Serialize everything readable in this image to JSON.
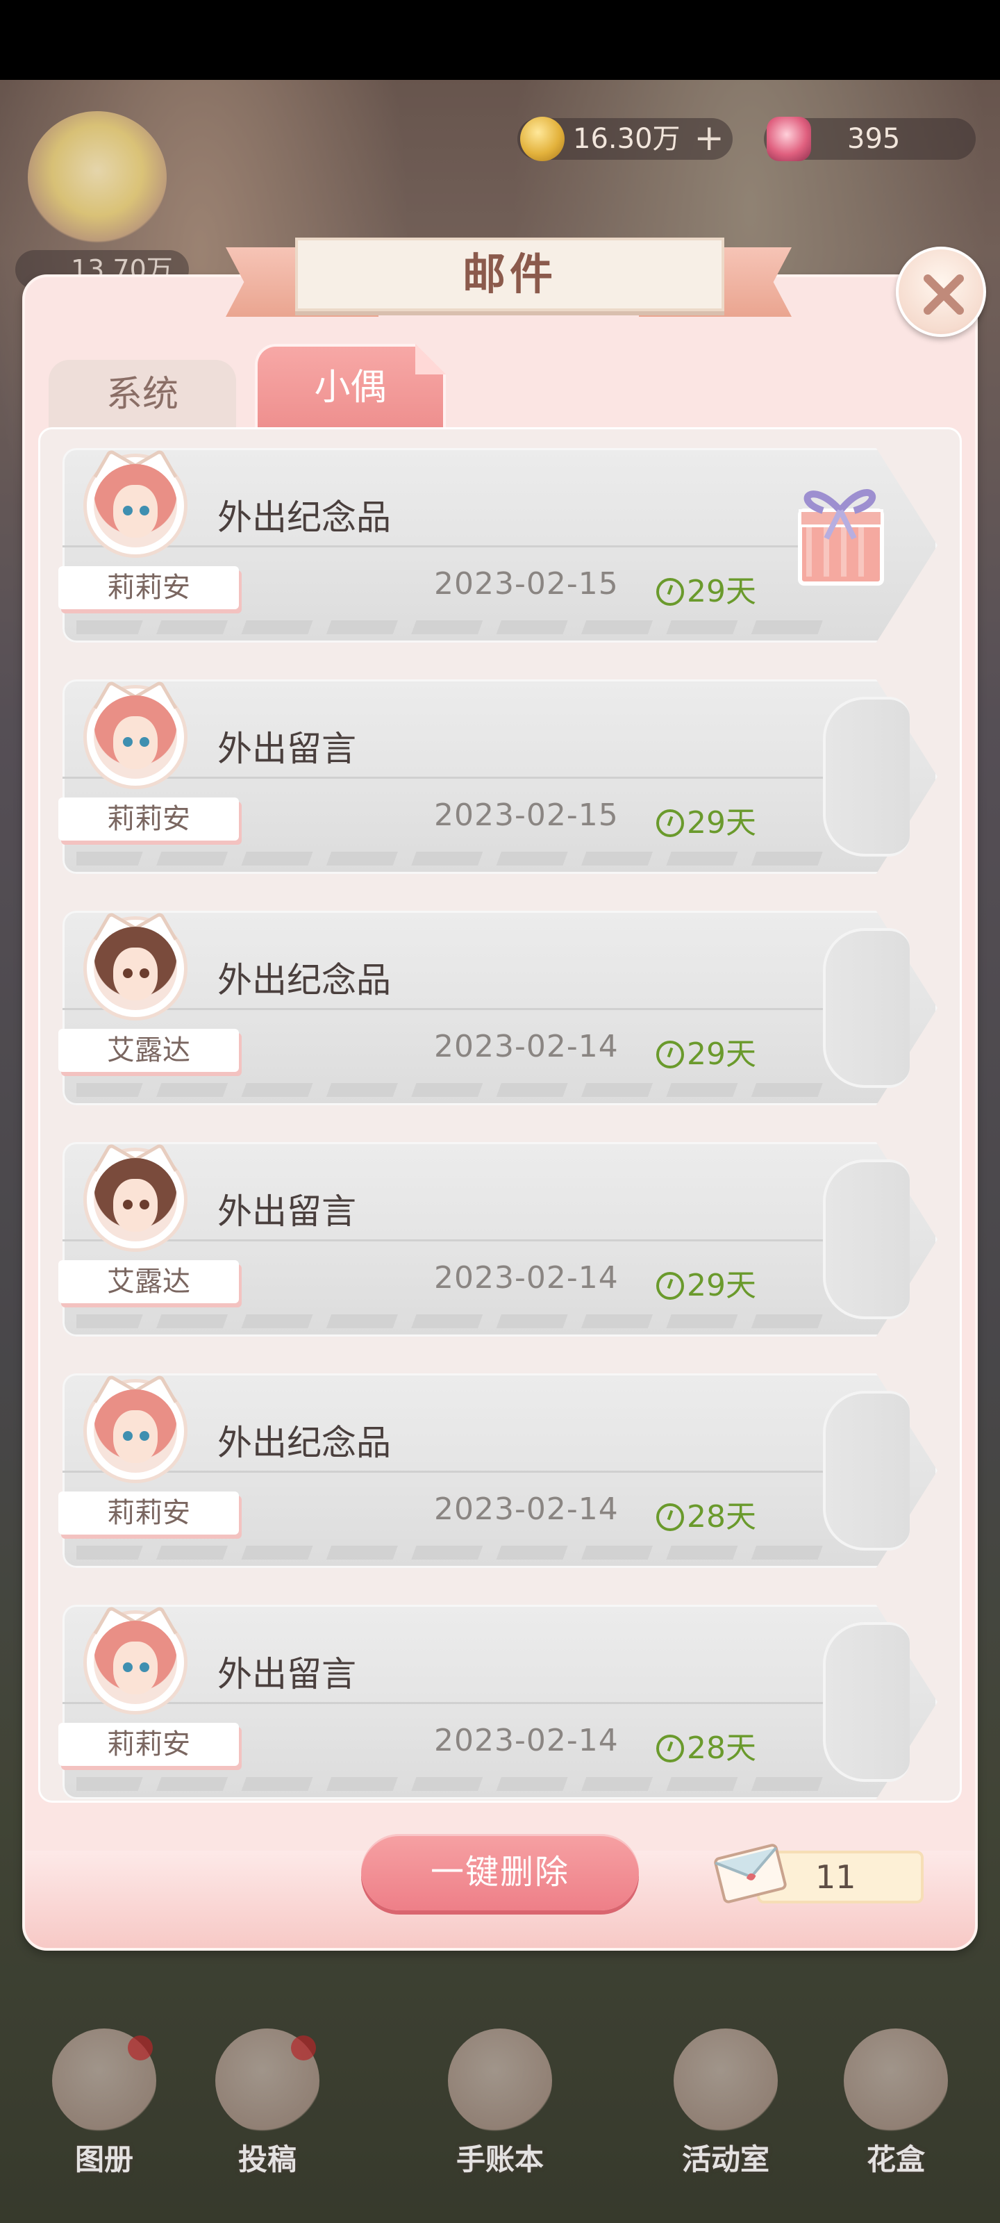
{
  "hud": {
    "coins": "16.30万",
    "gems": "395",
    "followers": "13.70万"
  },
  "modal": {
    "title": "邮件",
    "tabs": [
      {
        "label": "系统",
        "active": false
      },
      {
        "label": "小偶",
        "active": true
      }
    ],
    "delete_all_label": "一键删除",
    "mail_count": "11"
  },
  "mails": [
    {
      "sender": "莉莉安",
      "title": "外出纪念品",
      "date": "2023-02-15",
      "expiry": "29天",
      "has_gift": true
    },
    {
      "sender": "莉莉安",
      "title": "外出留言",
      "date": "2023-02-15",
      "expiry": "29天",
      "has_gift": false
    },
    {
      "sender": "艾露达",
      "title": "外出纪念品",
      "date": "2023-02-14",
      "expiry": "29天",
      "has_gift": false
    },
    {
      "sender": "艾露达",
      "title": "外出留言",
      "date": "2023-02-14",
      "expiry": "29天",
      "has_gift": false
    },
    {
      "sender": "莉莉安",
      "title": "外出纪念品",
      "date": "2023-02-14",
      "expiry": "28天",
      "has_gift": false
    },
    {
      "sender": "莉莉安",
      "title": "外出留言",
      "date": "2023-02-14",
      "expiry": "28天",
      "has_gift": false
    }
  ],
  "dock": [
    {
      "label": "图册"
    },
    {
      "label": "投稿"
    },
    {
      "label": "手账本"
    },
    {
      "label": "活动室"
    },
    {
      "label": "花盒"
    }
  ],
  "colors": {
    "accent_pink": "#ee8f8e",
    "expiry_green": "#6a9a2c",
    "title_brown": "#8b5a4c"
  }
}
